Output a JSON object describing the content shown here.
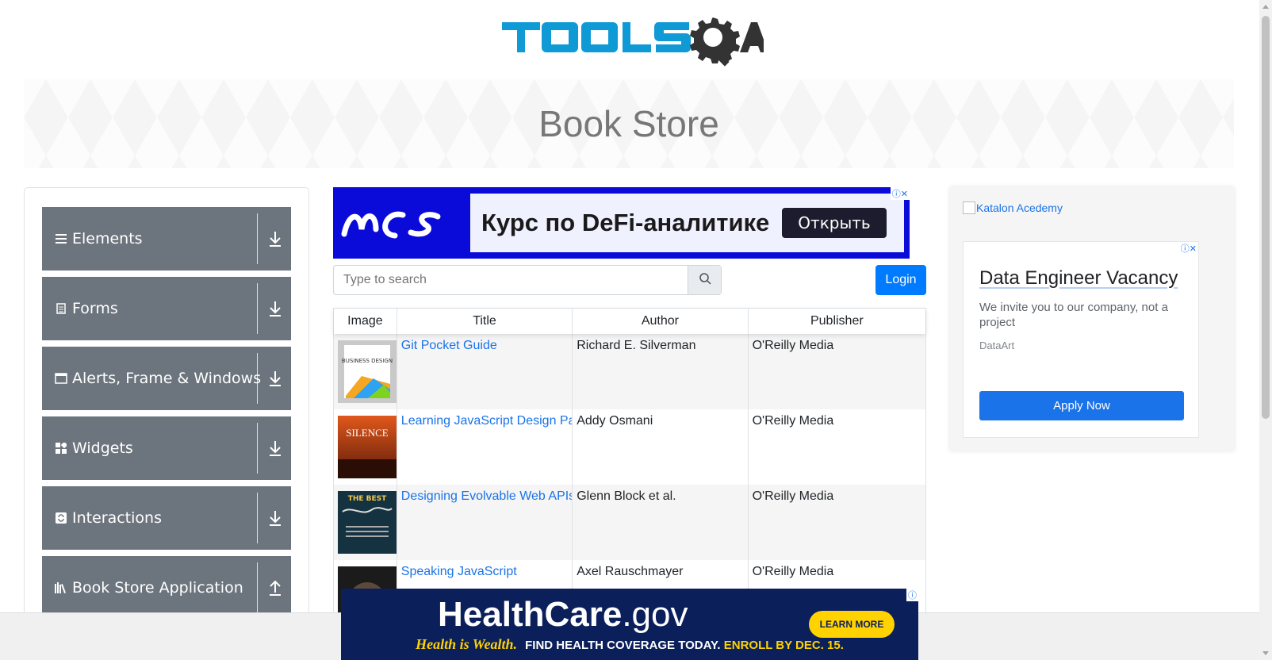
{
  "header": {
    "logo_text": "TOOLSQA",
    "title": "Book Store"
  },
  "sidebar": {
    "groups": [
      {
        "label": "Elements",
        "icon": "hamburger-icon",
        "arrow": "download-arrow-icon"
      },
      {
        "label": "Forms",
        "icon": "document-icon",
        "arrow": "download-arrow-icon"
      },
      {
        "label": "Alerts, Frame & Windows",
        "icon": "window-icon",
        "arrow": "download-arrow-icon"
      },
      {
        "label": "Widgets",
        "icon": "widgets-icon",
        "arrow": "download-arrow-icon"
      },
      {
        "label": "Interactions",
        "icon": "sync-icon",
        "arrow": "download-arrow-icon"
      },
      {
        "label": "Book Store Application",
        "icon": "books-icon",
        "arrow": "upload-arrow-icon"
      }
    ]
  },
  "top_ad": {
    "text": "Курс по DeFi-аналитике",
    "button": "Открыть",
    "logo": "MCS"
  },
  "search": {
    "placeholder": "Type to search",
    "value": ""
  },
  "login_label": "Login",
  "table": {
    "headers": [
      "Image",
      "Title",
      "Author",
      "Publisher"
    ],
    "rows": [
      {
        "title": "Git Pocket Guide",
        "author": "Richard E. Silverman",
        "publisher": "O'Reilly Media",
        "cover_text": "BUSINESS DESIGN"
      },
      {
        "title": "Learning JavaScript Design Patterns",
        "author": "Addy Osmani",
        "publisher": "O'Reilly Media",
        "cover_text": "SILENCE"
      },
      {
        "title": "Designing Evolvable Web APIs with ASP.NET",
        "author": "Glenn Block et al.",
        "publisher": "O'Reilly Media",
        "cover_text": "THE BEST"
      },
      {
        "title": "Speaking JavaScript",
        "author": "Axel Rauschmayer",
        "publisher": "O'Reilly Media",
        "cover_text": ""
      }
    ]
  },
  "right_ad": {
    "katalon_alt": "Katalon Acedemy",
    "job_title": "Data Engineer Vacancy",
    "description": "We invite you to our company, not a project",
    "company": "DataArt",
    "apply_label": "Apply Now"
  },
  "bottom_ad": {
    "brand_bold": "HealthCare",
    "brand_rest": ".gov",
    "tagline_script": "Health is Wealth.",
    "tagline_mid": "FIND HEALTH COVERAGE TODAY.",
    "tagline_end": "ENROLL BY DEC. 15.",
    "button": "LEARN MORE"
  },
  "colors": {
    "accent": "#007bff",
    "sidebar_group": "#6c757d",
    "link": "#1a73e8",
    "logo_blue": "#0f9ad6",
    "logo_dark": "#333333"
  }
}
